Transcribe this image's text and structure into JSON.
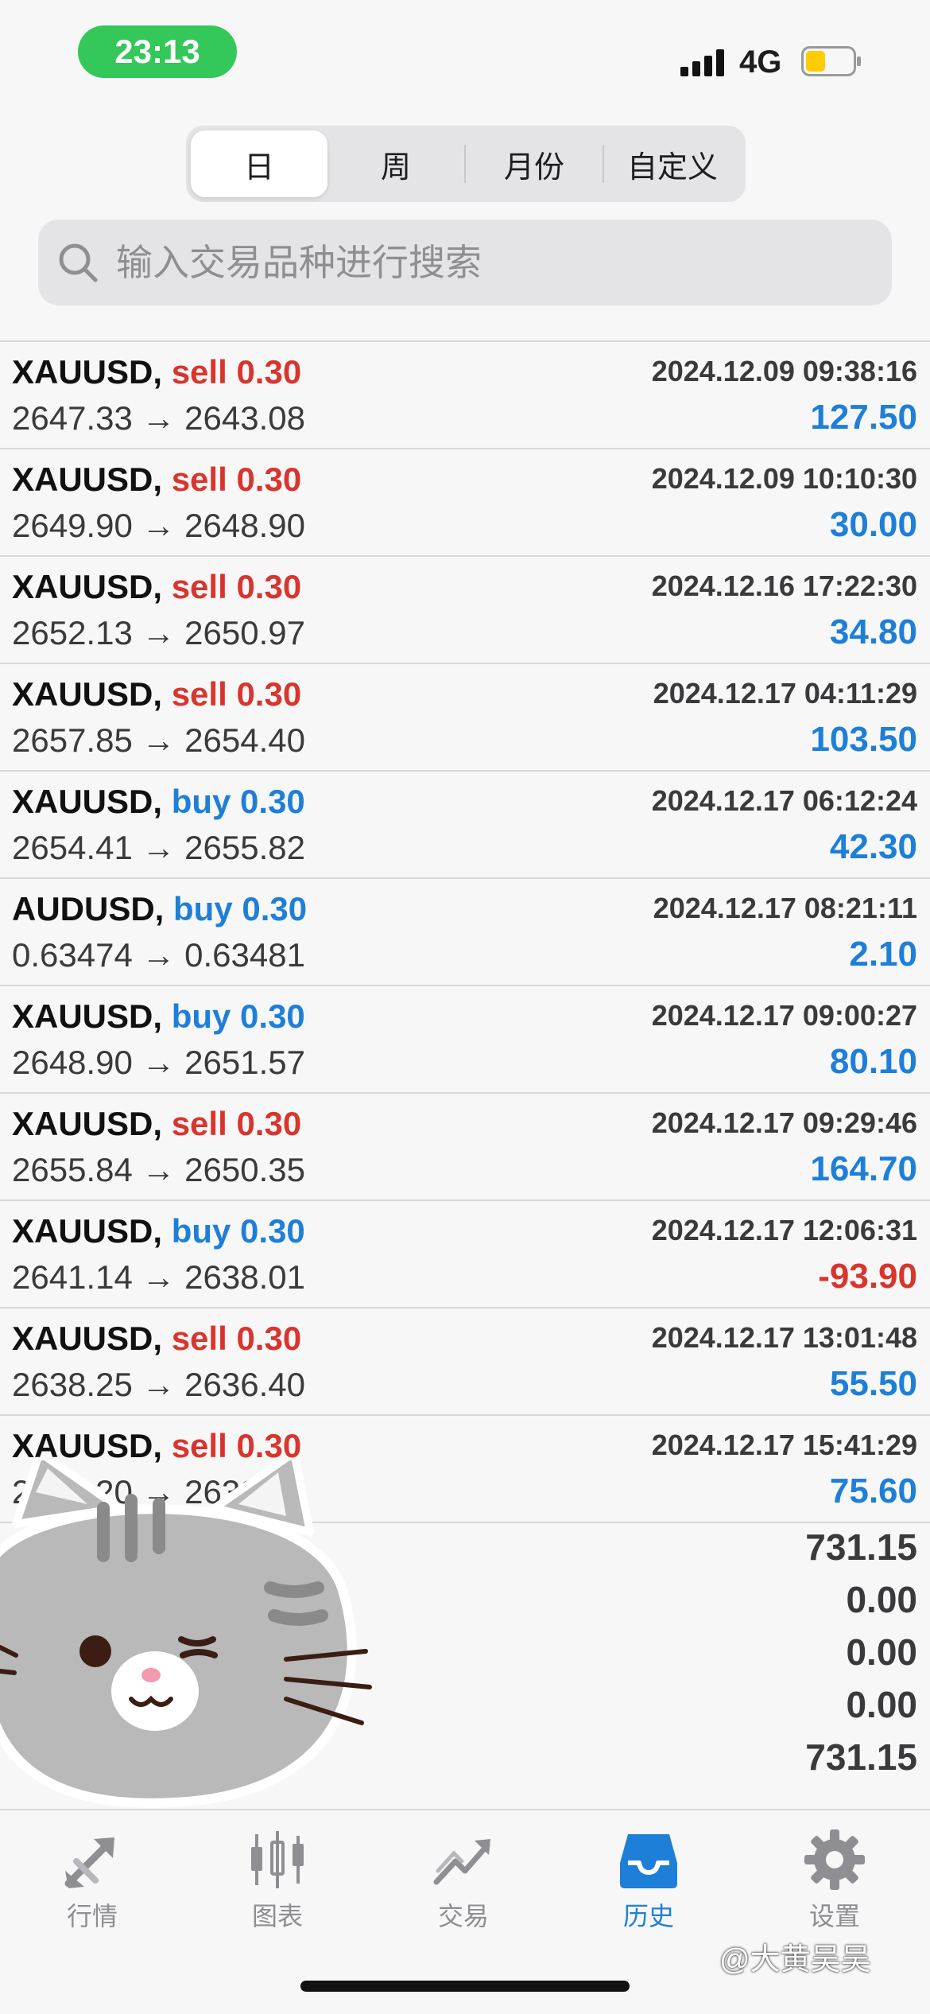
{
  "status": {
    "time": "23:13",
    "network": "4G",
    "colors": {
      "time_pill": "#34c759",
      "battery": "#ffcc00"
    }
  },
  "period_tabs": [
    {
      "label": "日",
      "active": true
    },
    {
      "label": "周",
      "active": false
    },
    {
      "label": "月份",
      "active": false
    },
    {
      "label": "自定义",
      "active": false
    }
  ],
  "search": {
    "placeholder": "输入交易品种进行搜索",
    "icon": "search-icon"
  },
  "trades": [
    {
      "symbol": "XAUUSD,",
      "side": "sell",
      "lot": "0.30",
      "time": "2024.12.09 09:38:16",
      "prices": "2647.33 → 2643.08",
      "profit": "127.50"
    },
    {
      "symbol": "XAUUSD,",
      "side": "sell",
      "lot": "0.30",
      "time": "2024.12.09 10:10:30",
      "prices": "2649.90 → 2648.90",
      "profit": "30.00"
    },
    {
      "symbol": "XAUUSD,",
      "side": "sell",
      "lot": "0.30",
      "time": "2024.12.16 17:22:30",
      "prices": "2652.13 → 2650.97",
      "profit": "34.80"
    },
    {
      "symbol": "XAUUSD,",
      "side": "sell",
      "lot": "0.30",
      "time": "2024.12.17 04:11:29",
      "prices": "2657.85 → 2654.40",
      "profit": "103.50"
    },
    {
      "symbol": "XAUUSD,",
      "side": "buy",
      "lot": "0.30",
      "time": "2024.12.17 06:12:24",
      "prices": "2654.41 → 2655.82",
      "profit": "42.30"
    },
    {
      "symbol": "AUDUSD,",
      "side": "buy",
      "lot": "0.30",
      "time": "2024.12.17 08:21:11",
      "prices": "0.63474 → 0.63481",
      "profit": "2.10"
    },
    {
      "symbol": "XAUUSD,",
      "side": "buy",
      "lot": "0.30",
      "time": "2024.12.17 09:00:27",
      "prices": "2648.90 → 2651.57",
      "profit": "80.10"
    },
    {
      "symbol": "XAUUSD,",
      "side": "sell",
      "lot": "0.30",
      "time": "2024.12.17 09:29:46",
      "prices": "2655.84 → 2650.35",
      "profit": "164.70"
    },
    {
      "symbol": "XAUUSD,",
      "side": "buy",
      "lot": "0.30",
      "time": "2024.12.17 12:06:31",
      "prices": "2641.14 → 2638.01",
      "profit": "-93.90"
    },
    {
      "symbol": "XAUUSD,",
      "side": "sell",
      "lot": "0.30",
      "time": "2024.12.17 13:01:48",
      "prices": "2638.25 → 2636.40",
      "profit": "55.50"
    },
    {
      "symbol": "XAUUSD,",
      "side": "sell",
      "lot": "0.30",
      "time": "2024.12.17 15:41:29",
      "prices": "2642.20 → 2639.68",
      "profit": "75.60"
    }
  ],
  "summary": [
    "731.15",
    "0.00",
    "0.00",
    "0.00",
    "731.15"
  ],
  "tabbar": [
    {
      "label": "行情",
      "icon": "quotes-arrows-icon",
      "active": false
    },
    {
      "label": "图表",
      "icon": "candlestick-chart-icon",
      "active": false
    },
    {
      "label": "交易",
      "icon": "trade-trend-icon",
      "active": false
    },
    {
      "label": "历史",
      "icon": "history-inbox-icon",
      "active": true
    },
    {
      "label": "设置",
      "icon": "gear-icon",
      "active": false
    }
  ],
  "watermark": "@大黄吴吴",
  "sticker": "winking-gray-cat-sticker",
  "colors": {
    "sell": "#d8352e",
    "buy": "#1e7fd8",
    "profit_positive": "#1e7fd8",
    "profit_negative": "#d8352e",
    "active_tab": "#1e7fd8"
  }
}
